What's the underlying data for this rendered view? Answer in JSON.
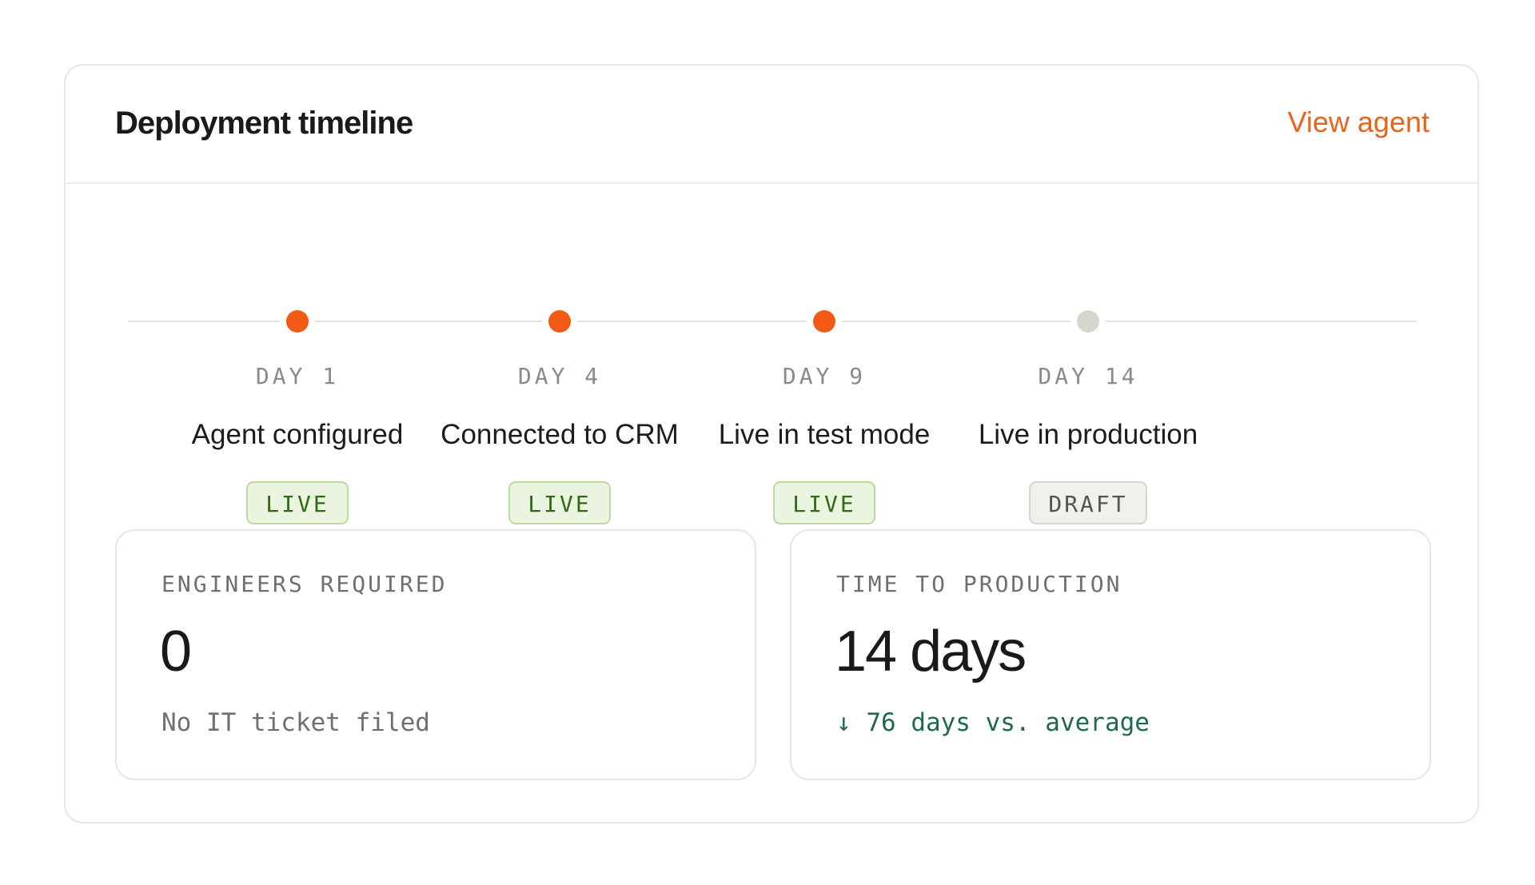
{
  "card": {
    "title": "Deployment timeline",
    "link_label": "View agent",
    "accent_color": "#f25a16",
    "link_color": "#e8641c"
  },
  "timeline": {
    "steps": [
      {
        "day": "DAY 1",
        "title": "Agent configured",
        "status": "LIVE",
        "state": "complete"
      },
      {
        "day": "DAY 4",
        "title": "Connected to CRM",
        "status": "LIVE",
        "state": "complete"
      },
      {
        "day": "DAY 9",
        "title": "Live in test mode",
        "status": "LIVE",
        "state": "complete"
      },
      {
        "day": "DAY 14",
        "title": "Live in production",
        "status": "DRAFT",
        "state": "pending"
      }
    ]
  },
  "stats": {
    "engineers": {
      "label": "ENGINEERS REQUIRED",
      "value": "0",
      "note": "No IT ticket filed"
    },
    "time_to_production": {
      "label": "TIME TO PRODUCTION",
      "value": "14 days",
      "note": "↓ 76 days vs. average",
      "note_color": "#1f6a4c"
    }
  }
}
